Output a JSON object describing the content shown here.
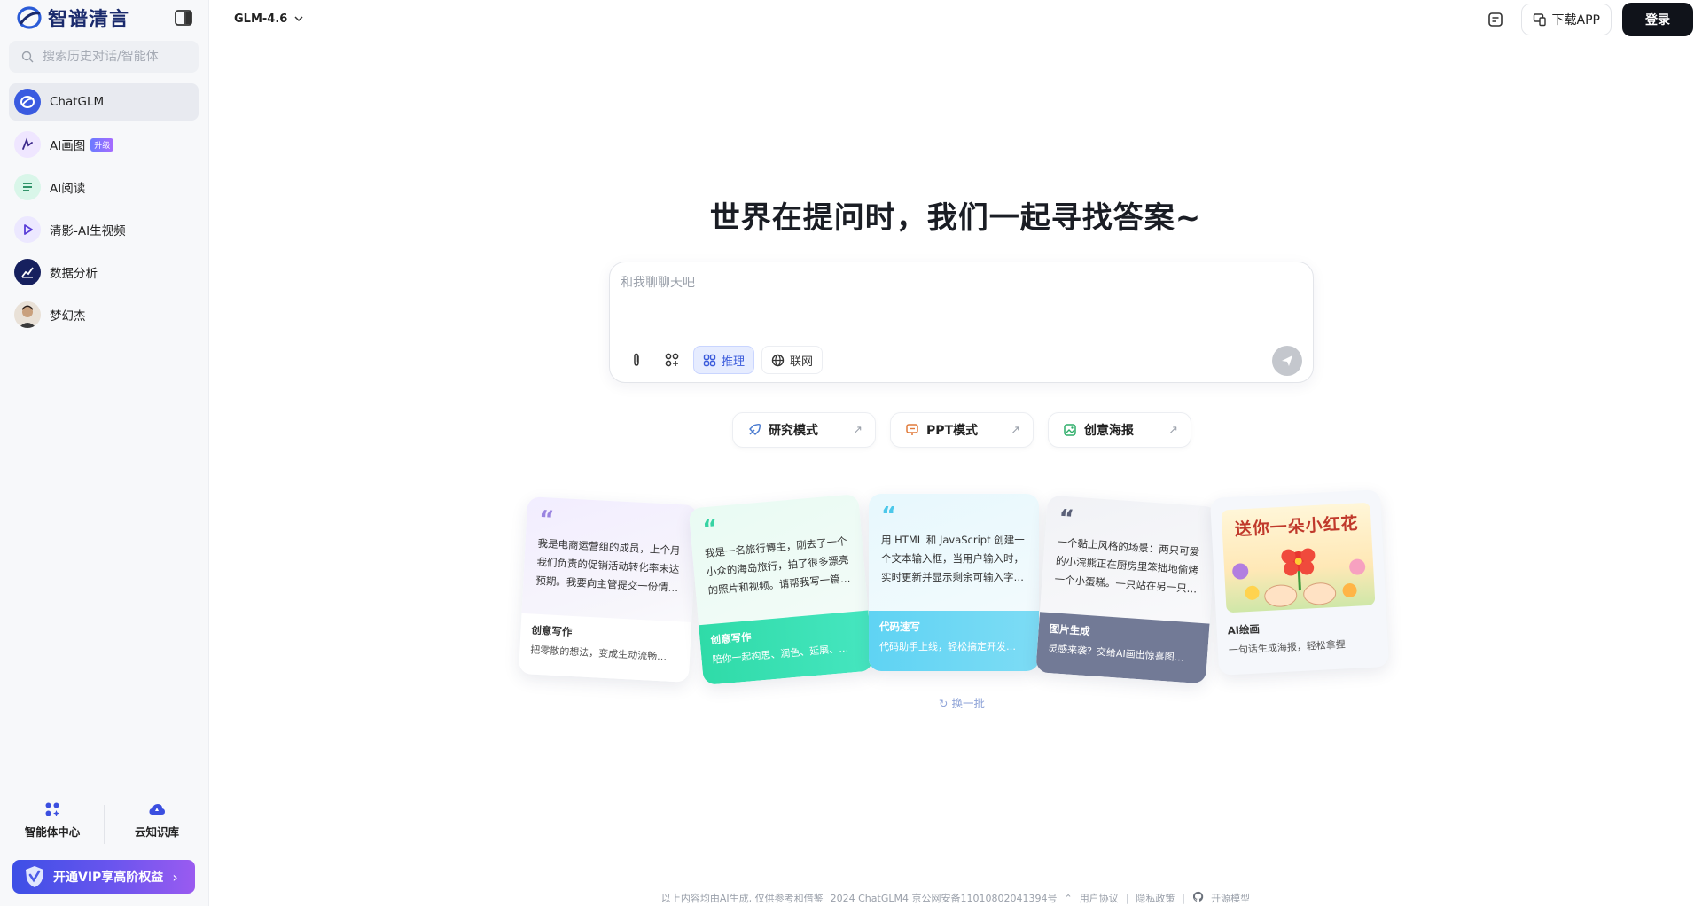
{
  "sidebar": {
    "brand_name": "智谱清言",
    "search_placeholder": "搜索历史对话/智能体",
    "items": [
      {
        "label": "ChatGLM",
        "icon": "chatglm-icon"
      },
      {
        "label": "AI画图",
        "badge": "升级",
        "icon": "ai-paint-icon"
      },
      {
        "label": "AI阅读",
        "icon": "ai-read-icon"
      },
      {
        "label": "清影-AI生视频",
        "icon": "video-icon"
      },
      {
        "label": "数据分析",
        "icon": "chart-icon"
      },
      {
        "label": "梦幻杰",
        "icon": "avatar"
      }
    ],
    "tools": [
      {
        "label": "智能体中心",
        "icon": "agents-grid-icon"
      },
      {
        "label": "云知识库",
        "icon": "cloud-kb-icon"
      }
    ],
    "vip_label": "开通VIP享高阶权益"
  },
  "topbar": {
    "model": "GLM-4.6",
    "download_label": "下载APP",
    "login_label": "登录"
  },
  "main": {
    "title": "世界在提问时，我们一起寻找答案~",
    "input_placeholder": "和我聊聊天吧",
    "tools": {
      "reason_label": "推理",
      "web_label": "联网"
    },
    "modes": [
      {
        "label": "研究模式",
        "icon": "research-icon",
        "arrow": "↗"
      },
      {
        "label": "PPT模式",
        "icon": "ppt-icon",
        "arrow": "↗"
      },
      {
        "label": "创意海报",
        "icon": "poster-icon",
        "arrow": "↗"
      }
    ],
    "cards": [
      {
        "text": "我是电商运营组的成员，上个月我们负责的促销活动转化率未达预期。我要向主管提交一份情…",
        "tag": "创意写作",
        "desc": "把零散的想法，变成生动流畅…"
      },
      {
        "text": "我是一名旅行博主，刚去了一个小众的海岛旅行，拍了很多漂亮的照片和视频。请帮我写一篇…",
        "tag": "创意写作",
        "desc": "陪你一起构思、润色、延展、…"
      },
      {
        "text": "用 HTML 和 JavaScript 创建一个文本输入框，当用户输入时，实时更新并显示剩余可输入字…",
        "tag": "代码速写",
        "desc": "代码助手上线，轻松搞定开发…"
      },
      {
        "text": "一个黏土风格的场景：两只可爱的小浣熊正在厨房里笨拙地偷烤一个小蛋糕。一只站在另一只…",
        "tag": "图片生成",
        "desc": "灵感来袭？交给AI画出惊喜图…"
      },
      {
        "poster_title": "送你一朵小红花",
        "tag": "AI绘画",
        "desc": "一句话生成海报，轻松拿捏"
      }
    ],
    "refresh_label": "换一批"
  },
  "footer": {
    "disclaimer": "以上内容均由AI生成, 仅供参考和借鉴",
    "icp": "2024 ChatGLM4 京公网安备11010802041394号",
    "user_agreement": "用户协议",
    "privacy": "隐私政策",
    "open_source": "开源模型"
  },
  "colors": {
    "brand": "#1a2a6c",
    "accent": "#3b5bdb",
    "login_bg": "#10131a",
    "vip_gradient_start": "#3d4fe6",
    "vip_gradient_end": "#9a5bf0"
  }
}
